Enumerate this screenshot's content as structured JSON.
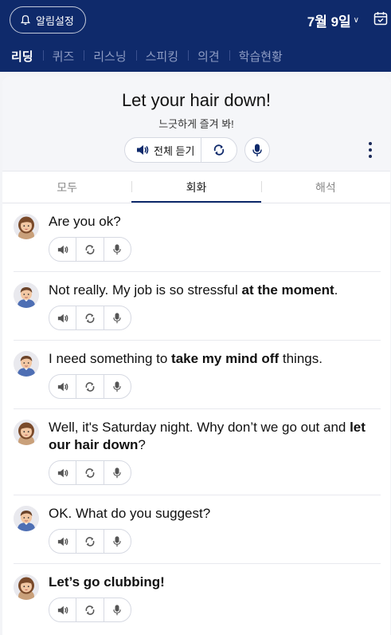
{
  "top": {
    "alarm_label": "알림설정",
    "date": "7월 9일"
  },
  "nav": [
    {
      "label": "리딩",
      "active": true
    },
    {
      "label": "퀴즈",
      "active": false
    },
    {
      "label": "리스닝",
      "active": false
    },
    {
      "label": "스피킹",
      "active": false
    },
    {
      "label": "의견",
      "active": false
    },
    {
      "label": "학습현황",
      "active": false
    }
  ],
  "lesson": {
    "title": "Let your hair down!",
    "subtitle": "느긋하게 즐겨 봐!",
    "listen_all": "전체 듣기"
  },
  "segments": [
    {
      "label": "모두",
      "active": false
    },
    {
      "label": "회화",
      "active": true
    },
    {
      "label": "해석",
      "active": false
    }
  ],
  "dialogs": [
    {
      "speaker": "female",
      "parts": [
        {
          "t": "Are you ok?",
          "b": false
        }
      ]
    },
    {
      "speaker": "male",
      "parts": [
        {
          "t": "Not really. My job is so stressful ",
          "b": false
        },
        {
          "t": "at the moment",
          "b": true
        },
        {
          "t": ".",
          "b": false
        }
      ]
    },
    {
      "speaker": "male",
      "parts": [
        {
          "t": "I need something to ",
          "b": false
        },
        {
          "t": "take my mind off",
          "b": true
        },
        {
          "t": " things.",
          "b": false
        }
      ]
    },
    {
      "speaker": "female",
      "parts": [
        {
          "t": "Well, it's Saturday night. Why don’t we go out and ",
          "b": false
        },
        {
          "t": "let our hair down",
          "b": true
        },
        {
          "t": "?",
          "b": false
        }
      ]
    },
    {
      "speaker": "male",
      "parts": [
        {
          "t": "OK. What do you suggest?",
          "b": false
        }
      ]
    },
    {
      "speaker": "female",
      "parts": [
        {
          "t": "Let’s go clubbing!",
          "b": true
        }
      ]
    }
  ],
  "colors": {
    "navy": "#0f2a6b",
    "nav_inactive": "#8e9cc3"
  },
  "icons": [
    "bell-icon",
    "calendar-icon",
    "speaker-icon",
    "repeat-icon",
    "mic-icon",
    "more-vertical-icon",
    "avatar-female",
    "avatar-male"
  ]
}
